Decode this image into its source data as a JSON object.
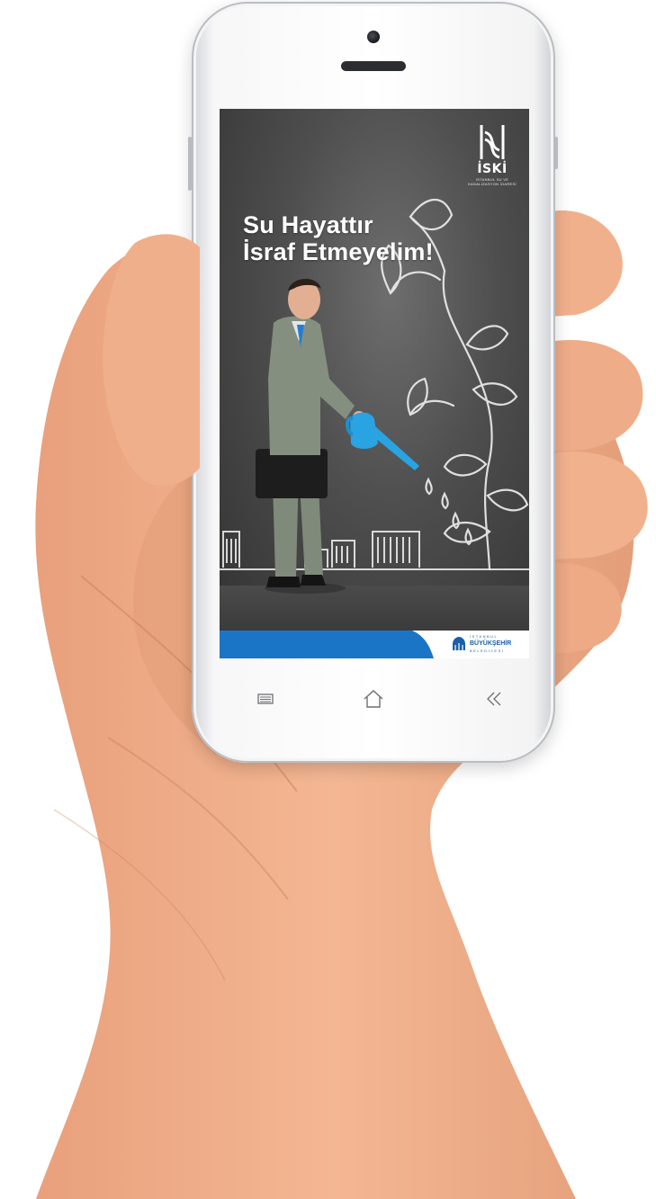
{
  "poster": {
    "headline_line1": "Su Hayattır",
    "headline_line2": "İsraf Etmeyelim!",
    "logo_text": "İSKİ",
    "logo_subtitle": "İSTANBUL SU VE KANALİZASYON İDARESİ",
    "footer_org_small": "İSTANBUL",
    "footer_org_name": "BÜYÜKŞEHİR",
    "footer_org_sub": "BELEDİYESİ"
  },
  "navbar": {
    "menu_icon": "menu-icon",
    "home_icon": "home-icon",
    "back_icon": "back-icon"
  },
  "colors": {
    "accent_blue": "#1a75c6",
    "skin": "#f1b08c"
  }
}
